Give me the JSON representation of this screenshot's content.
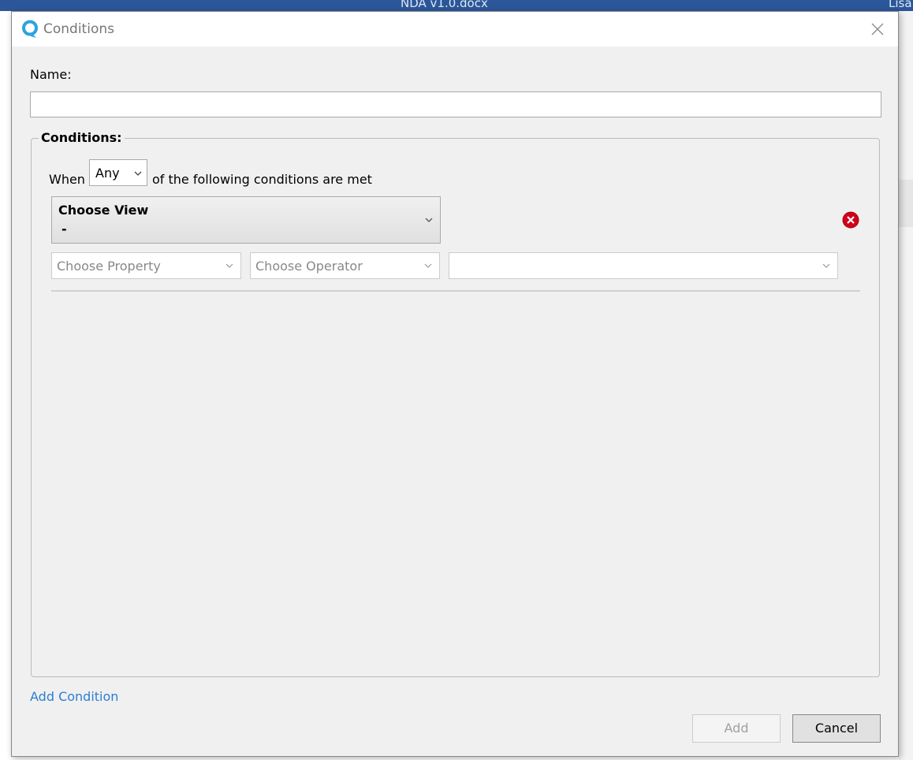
{
  "app": {
    "document_title": "NDA v1.0.docx",
    "user": "Lisa"
  },
  "dialog": {
    "title": "Conditions",
    "logo_icon": "q-logo-icon",
    "accent": "#2a7fd4",
    "name_label": "Name:",
    "name_value": "",
    "conditions_legend": "Conditions:",
    "when_label": "When",
    "match_select": "Any",
    "after_label": "of the following conditions are met",
    "condition": {
      "view_title": "Choose View",
      "view_value": "-",
      "property_placeholder": "Choose Property",
      "operator_placeholder": "Choose Operator",
      "value": ""
    },
    "add_condition": "Add Condition",
    "add_button": "Add",
    "cancel_button": "Cancel"
  }
}
